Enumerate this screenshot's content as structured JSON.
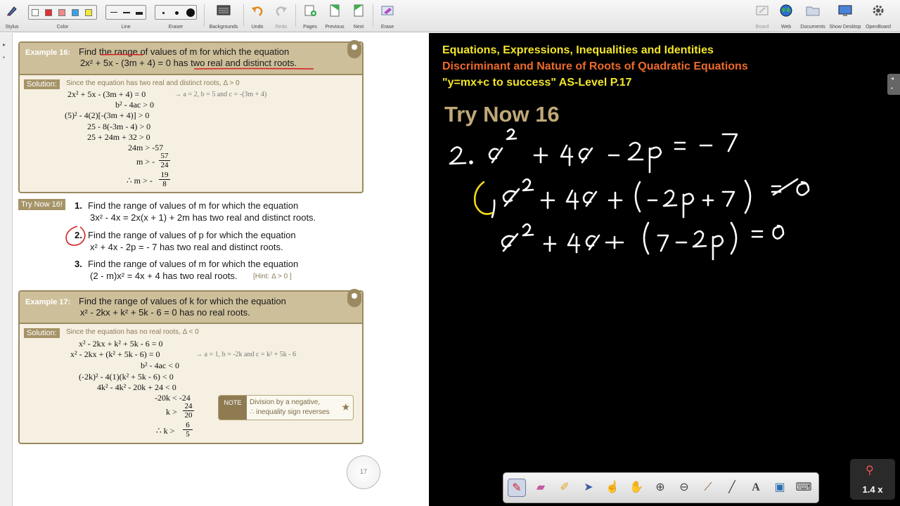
{
  "toolbar": {
    "items": [
      {
        "label": "Stylus",
        "icon": "stylus-icon"
      },
      {
        "label": "Color",
        "icon": "color-palette-icon"
      },
      {
        "label": "Line",
        "icon": "line-width-icon"
      },
      {
        "label": "Eraser",
        "icon": "eraser-size-icon"
      },
      {
        "label": "Backgrounds",
        "icon": "backgrounds-icon"
      },
      {
        "label": "Undo",
        "icon": "undo-icon"
      },
      {
        "label": "Redo",
        "icon": "redo-icon"
      },
      {
        "label": "Pages",
        "icon": "pages-icon"
      },
      {
        "label": "Previous",
        "icon": "previous-page-icon"
      },
      {
        "label": "Next",
        "icon": "next-page-icon"
      },
      {
        "label": "Erase",
        "icon": "erase-icon"
      },
      {
        "label": "Board",
        "icon": "board-icon"
      },
      {
        "label": "Web",
        "icon": "web-globe-icon"
      },
      {
        "label": "Documents",
        "icon": "documents-folder-icon"
      },
      {
        "label": "Show Desktop",
        "icon": "show-desktop-icon"
      },
      {
        "label": "OpenBoard",
        "icon": "openboard-settings-icon"
      }
    ],
    "colors": [
      "#ffffff",
      "#e03030",
      "#f08a8a",
      "#3aa0e8",
      "#f3e83a"
    ]
  },
  "example16": {
    "label": "Example 16:",
    "q_line1": "Find the range of values of m for which the equation",
    "q_line2": "2x² + 5x - (3m + 4) = 0  has two real and distinct roots.",
    "solution_label": "Solution:",
    "sol_note": "Since the equation has two real and distinct roots,  Δ > 0",
    "steps": [
      "2x² + 5x - (3m + 4) = 0",
      "b² - 4ac > 0",
      "(5)² - 4(2)[-(3m + 4)] > 0",
      "25 - 8(-3m - 4) > 0",
      "25 + 24m + 32 > 0",
      "24m > -57",
      "m > -",
      "∴  m > -"
    ],
    "coef_note": "→  a = 2, b = 5 and c = -(3m + 4)",
    "frac1_num": "57",
    "frac1_den": "24",
    "frac2_num": "19",
    "frac2_den": "8"
  },
  "try_now": {
    "tag": "Try Now 16!",
    "questions": [
      {
        "num": "1.",
        "line1": "Find the range of values of m for which the equation",
        "line2": "3x² - 4x = 2x(x + 1) + 2m  has two real and distinct roots.",
        "hint": ""
      },
      {
        "num": "2.",
        "line1": "Find the range of values of p for which the equation",
        "line2": "x² + 4x - 2p = - 7  has two real and distinct roots.",
        "hint": ""
      },
      {
        "num": "3.",
        "line1": "Find the range of values of m for which the equation",
        "line2": "(2 - m)x² = 4x + 4  has two real roots.",
        "hint": "[Hint: Δ > 0 ]"
      }
    ]
  },
  "example17": {
    "label": "Example 17:",
    "q_line1": "Find the range of values of k for which the equation",
    "q_line2": "x² - 2kx + k² + 5k - 6 = 0  has no real roots.",
    "solution_label": "Solution:",
    "sol_note": "Since the equation has no real roots,  Δ < 0",
    "steps": [
      "x² - 2kx + k² + 5k - 6 = 0",
      "x² - 2kx + (k² + 5k - 6) = 0",
      "b² - 4ac < 0",
      "(-2k)² - 4(1)(k² + 5k - 6) < 0",
      "4k² - 4k² - 20k + 24 < 0",
      "-20k < -24",
      "k >",
      "∴  k >"
    ],
    "coef_note": "→  a = 1, b = -2k and c = k² + 5k - 6",
    "frac1_num": "24",
    "frac1_den": "20",
    "frac2_num": "6",
    "frac2_den": "5",
    "note_tag": "NOTE",
    "note_line1": "Division by a negative,",
    "note_line2": "∴  inequality sign reverses"
  },
  "page_number": "17",
  "board": {
    "header1": "Equations, Expressions, Inequalities and Identities",
    "header2": "Discriminant and Nature of Roots of Quadratic Equations",
    "header3": "\"y=mx+c to success\"  AS-Level P.17",
    "header_colors": [
      "#f2e52a",
      "#ee6a2a",
      "#f2e52a"
    ],
    "try_now": "Try Now 16",
    "ink_color": "#ffffff",
    "ink_highlight": "#f2d81a"
  },
  "float_toolbar": {
    "tools": [
      "pen-icon",
      "eraser-icon",
      "marker-icon",
      "selector-icon",
      "laser-pointer-icon",
      "hand-icon",
      "zoom-in-icon",
      "zoom-out-icon",
      "brush-icon",
      "line-icon",
      "text-icon",
      "capture-icon",
      "keyboard-icon"
    ]
  },
  "zoom": "1.4 x"
}
